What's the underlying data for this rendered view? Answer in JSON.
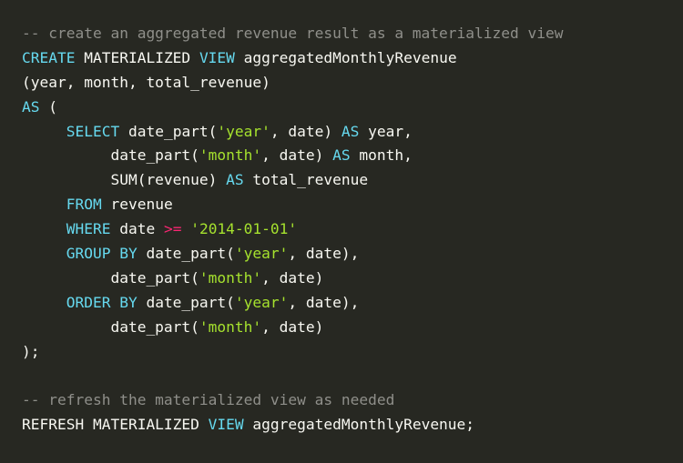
{
  "colors": {
    "background": "#272822",
    "plain": "#f8f8f2",
    "comment": "#8f8f8a",
    "keyword": "#66d9ef",
    "string": "#a6e22e",
    "operator": "#f92672"
  },
  "code": {
    "lines": [
      [
        {
          "t": "comment",
          "v": "-- create an aggregated revenue result as a materialized view"
        }
      ],
      [
        {
          "t": "keyword",
          "v": "CREATE"
        },
        {
          "t": "plain",
          "v": " MATERIALIZED "
        },
        {
          "t": "keyword",
          "v": "VIEW"
        },
        {
          "t": "plain",
          "v": " aggregatedMonthlyRevenue"
        }
      ],
      [
        {
          "t": "plain",
          "v": "(year, month, total_revenue)"
        }
      ],
      [
        {
          "t": "keyword",
          "v": "AS"
        },
        {
          "t": "plain",
          "v": " ("
        }
      ],
      [
        {
          "t": "plain",
          "v": "     "
        },
        {
          "t": "keyword",
          "v": "SELECT"
        },
        {
          "t": "plain",
          "v": " date_part("
        },
        {
          "t": "string",
          "v": "'year'"
        },
        {
          "t": "plain",
          "v": ", date) "
        },
        {
          "t": "keyword",
          "v": "AS"
        },
        {
          "t": "plain",
          "v": " year,"
        }
      ],
      [
        {
          "t": "plain",
          "v": "          date_part("
        },
        {
          "t": "string",
          "v": "'month'"
        },
        {
          "t": "plain",
          "v": ", date) "
        },
        {
          "t": "keyword",
          "v": "AS"
        },
        {
          "t": "plain",
          "v": " month,"
        }
      ],
      [
        {
          "t": "plain",
          "v": "          SUM(revenue) "
        },
        {
          "t": "keyword",
          "v": "AS"
        },
        {
          "t": "plain",
          "v": " total_revenue"
        }
      ],
      [
        {
          "t": "plain",
          "v": "     "
        },
        {
          "t": "keyword",
          "v": "FROM"
        },
        {
          "t": "plain",
          "v": " revenue"
        }
      ],
      [
        {
          "t": "plain",
          "v": "     "
        },
        {
          "t": "keyword",
          "v": "WHERE"
        },
        {
          "t": "plain",
          "v": " date "
        },
        {
          "t": "operator",
          "v": ">="
        },
        {
          "t": "plain",
          "v": " "
        },
        {
          "t": "string",
          "v": "'2014-01-01'"
        }
      ],
      [
        {
          "t": "plain",
          "v": "     "
        },
        {
          "t": "keyword",
          "v": "GROUP BY"
        },
        {
          "t": "plain",
          "v": " date_part("
        },
        {
          "t": "string",
          "v": "'year'"
        },
        {
          "t": "plain",
          "v": ", date),"
        }
      ],
      [
        {
          "t": "plain",
          "v": "          date_part("
        },
        {
          "t": "string",
          "v": "'month'"
        },
        {
          "t": "plain",
          "v": ", date)"
        }
      ],
      [
        {
          "t": "plain",
          "v": "     "
        },
        {
          "t": "keyword",
          "v": "ORDER BY"
        },
        {
          "t": "plain",
          "v": " date_part("
        },
        {
          "t": "string",
          "v": "'year'"
        },
        {
          "t": "plain",
          "v": ", date),"
        }
      ],
      [
        {
          "t": "plain",
          "v": "          date_part("
        },
        {
          "t": "string",
          "v": "'month'"
        },
        {
          "t": "plain",
          "v": ", date)"
        }
      ],
      [
        {
          "t": "plain",
          "v": ");"
        }
      ],
      [],
      [
        {
          "t": "comment",
          "v": "-- refresh the materialized view as needed"
        }
      ],
      [
        {
          "t": "plain",
          "v": "REFRESH MATERIALIZED "
        },
        {
          "t": "keyword",
          "v": "VIEW"
        },
        {
          "t": "plain",
          "v": " aggregatedMonthlyRevenue;"
        }
      ]
    ]
  }
}
